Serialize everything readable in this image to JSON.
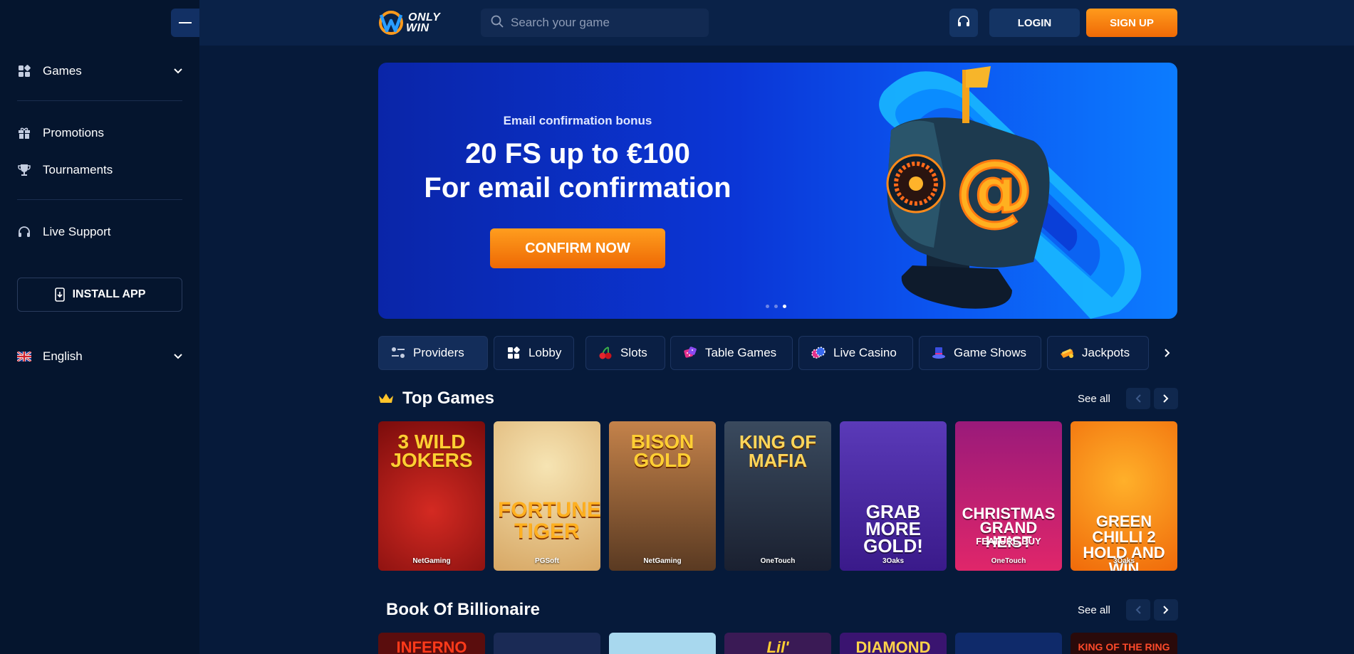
{
  "sidebar": {
    "games_label": "Games",
    "promotions_label": "Promotions",
    "tournaments_label": "Tournaments",
    "live_support_label": "Live Support",
    "install_label": "INSTALL APP",
    "language_label": "English"
  },
  "header": {
    "logo_line1": "ONLY",
    "logo_line2": "WIN",
    "search_placeholder": "Search your game",
    "login_label": "LOGIN",
    "signup_label": "SIGN UP"
  },
  "banner": {
    "subtitle": "Email confirmation bonus",
    "title_line1": "20 FS up to €100",
    "title_line2": "For email confirmation",
    "cta_label": "CONFIRM NOW",
    "active_slide": 3,
    "slide_count": 3
  },
  "categories": [
    {
      "label": "Providers",
      "icon": "providers-icon"
    },
    {
      "label": "Lobby",
      "icon": "lobby-icon"
    },
    {
      "label": "Slots",
      "icon": "cherries-icon"
    },
    {
      "label": "Table Games",
      "icon": "dice-icon"
    },
    {
      "label": "Live Casino",
      "icon": "chips-icon"
    },
    {
      "label": "Game Shows",
      "icon": "top-hat-icon"
    },
    {
      "label": "Jackpots",
      "icon": "jackpot-icon"
    }
  ],
  "top_games": {
    "title": "Top Games",
    "see_all": "See all",
    "games": [
      {
        "name": "3 Wild Jokers",
        "logo": "3 WILD JOKERS",
        "provider": "NetGaming",
        "bg": "#8c1414"
      },
      {
        "name": "Fortune Tiger",
        "logo": "FORTUNE TIGER",
        "provider": "PGSoft",
        "bg": "#e9c780"
      },
      {
        "name": "Bison Gold",
        "logo": "BISON GOLD",
        "provider": "NetGaming",
        "bg": "#7a5a3a"
      },
      {
        "name": "King of Mafia",
        "logo": "KING OF MAFIA",
        "provider": "OneTouch",
        "bg": "#2b3142"
      },
      {
        "name": "Grab More Gold!",
        "logo": "GRAB MORE GOLD!",
        "provider": "3Oaks",
        "bg": "#4b2a9a"
      },
      {
        "name": "Christmas Grand Heist Feature Buy",
        "logo": "CHRISTMAS GRAND HEIST",
        "tag": "FEATURE BUY",
        "provider": "OneTouch",
        "bg": "#c71a6a"
      },
      {
        "name": "Green Chilli 2 Hold and Win",
        "logo": "GREEN CHILLI 2 HOLD AND WIN",
        "provider": "3Oaks",
        "bg": "#ff7a12"
      }
    ]
  },
  "book_section": {
    "title": "Book Of Billionaire",
    "see_all": "See all",
    "games": [
      {
        "logo": "INFERNO",
        "bg": "#5a0d0d",
        "color": "#ff3a1a"
      },
      {
        "logo": "",
        "bg": "#1a2a55",
        "color": "#fff"
      },
      {
        "logo": "",
        "bg": "#a8d8ee",
        "color": "#fff"
      },
      {
        "logo": "Lil'",
        "bg": "#3a1a55",
        "color": "#ffcf33"
      },
      {
        "logo": "DIAMOND",
        "bg": "#3a1470",
        "color": "#ffd34a"
      },
      {
        "logo": "",
        "bg": "#0f2a6a",
        "color": "#fff"
      },
      {
        "logo": "KING OF THE RING",
        "bg": "#2a0a0a",
        "color": "#ff4a2a"
      }
    ]
  },
  "colors": {
    "accent_orange": "#ff8a10",
    "sidebar_bg": "#05152e",
    "page_bg": "#061a3a"
  }
}
